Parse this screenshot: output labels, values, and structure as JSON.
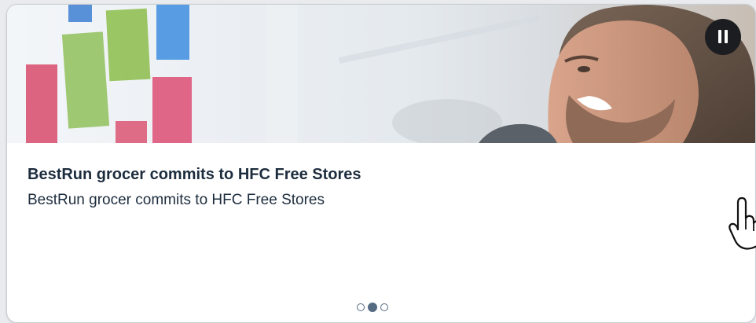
{
  "card": {
    "title": "BestRun grocer commits to HFC Free Stores",
    "subtitle": "BestRun grocer commits to HFC Free Stores"
  },
  "controls": {
    "pause_icon": "pause-icon"
  },
  "pagination": {
    "total": 3,
    "active_index": 1
  },
  "cursor": {
    "icon": "hand-pointer-icon"
  }
}
